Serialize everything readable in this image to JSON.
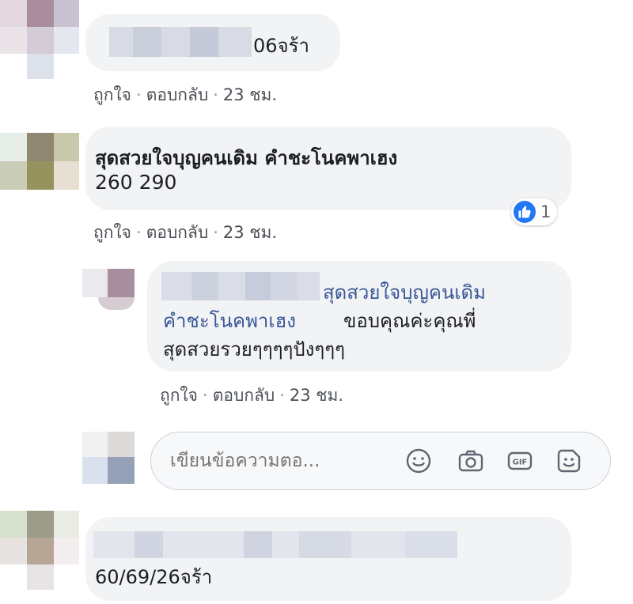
{
  "comments": [
    {
      "text": "06จร้า",
      "actions": {
        "like": "ถูกใจ",
        "reply": "ตอบกลับ",
        "time": "23 ชม."
      }
    },
    {
      "author": "สุดสวยใจบุญคนเดิม คำชะโนคพาเฮง",
      "text": "260 290",
      "reaction_count": "1",
      "actions": {
        "like": "ถูกใจ",
        "reply": "ตอบกลับ",
        "time": "23 ชม."
      }
    },
    {
      "mention_line1": "สุดสวยใจบุญคนเดิม",
      "mention_line2": "คำชะโนคพาเฮง",
      "text_line2": "ขอบคุณค่ะคุณพี่",
      "text_line3": "สุดสวยรวยๆๆๆๆปังๆๆๆ",
      "actions": {
        "like": "ถูกใจ",
        "reply": "ตอบกลับ",
        "time": "23 ชม."
      }
    },
    {
      "text": "60/69/26จร้า"
    }
  ],
  "composer": {
    "placeholder": "เขียนข้อความตอ...",
    "icons": [
      "emoji-icon",
      "camera-icon",
      "gif-icon",
      "sticker-icon"
    ]
  },
  "colors": {
    "link": "#385898",
    "bubble": "#f2f3f5",
    "like_blue": "#2078f4"
  }
}
